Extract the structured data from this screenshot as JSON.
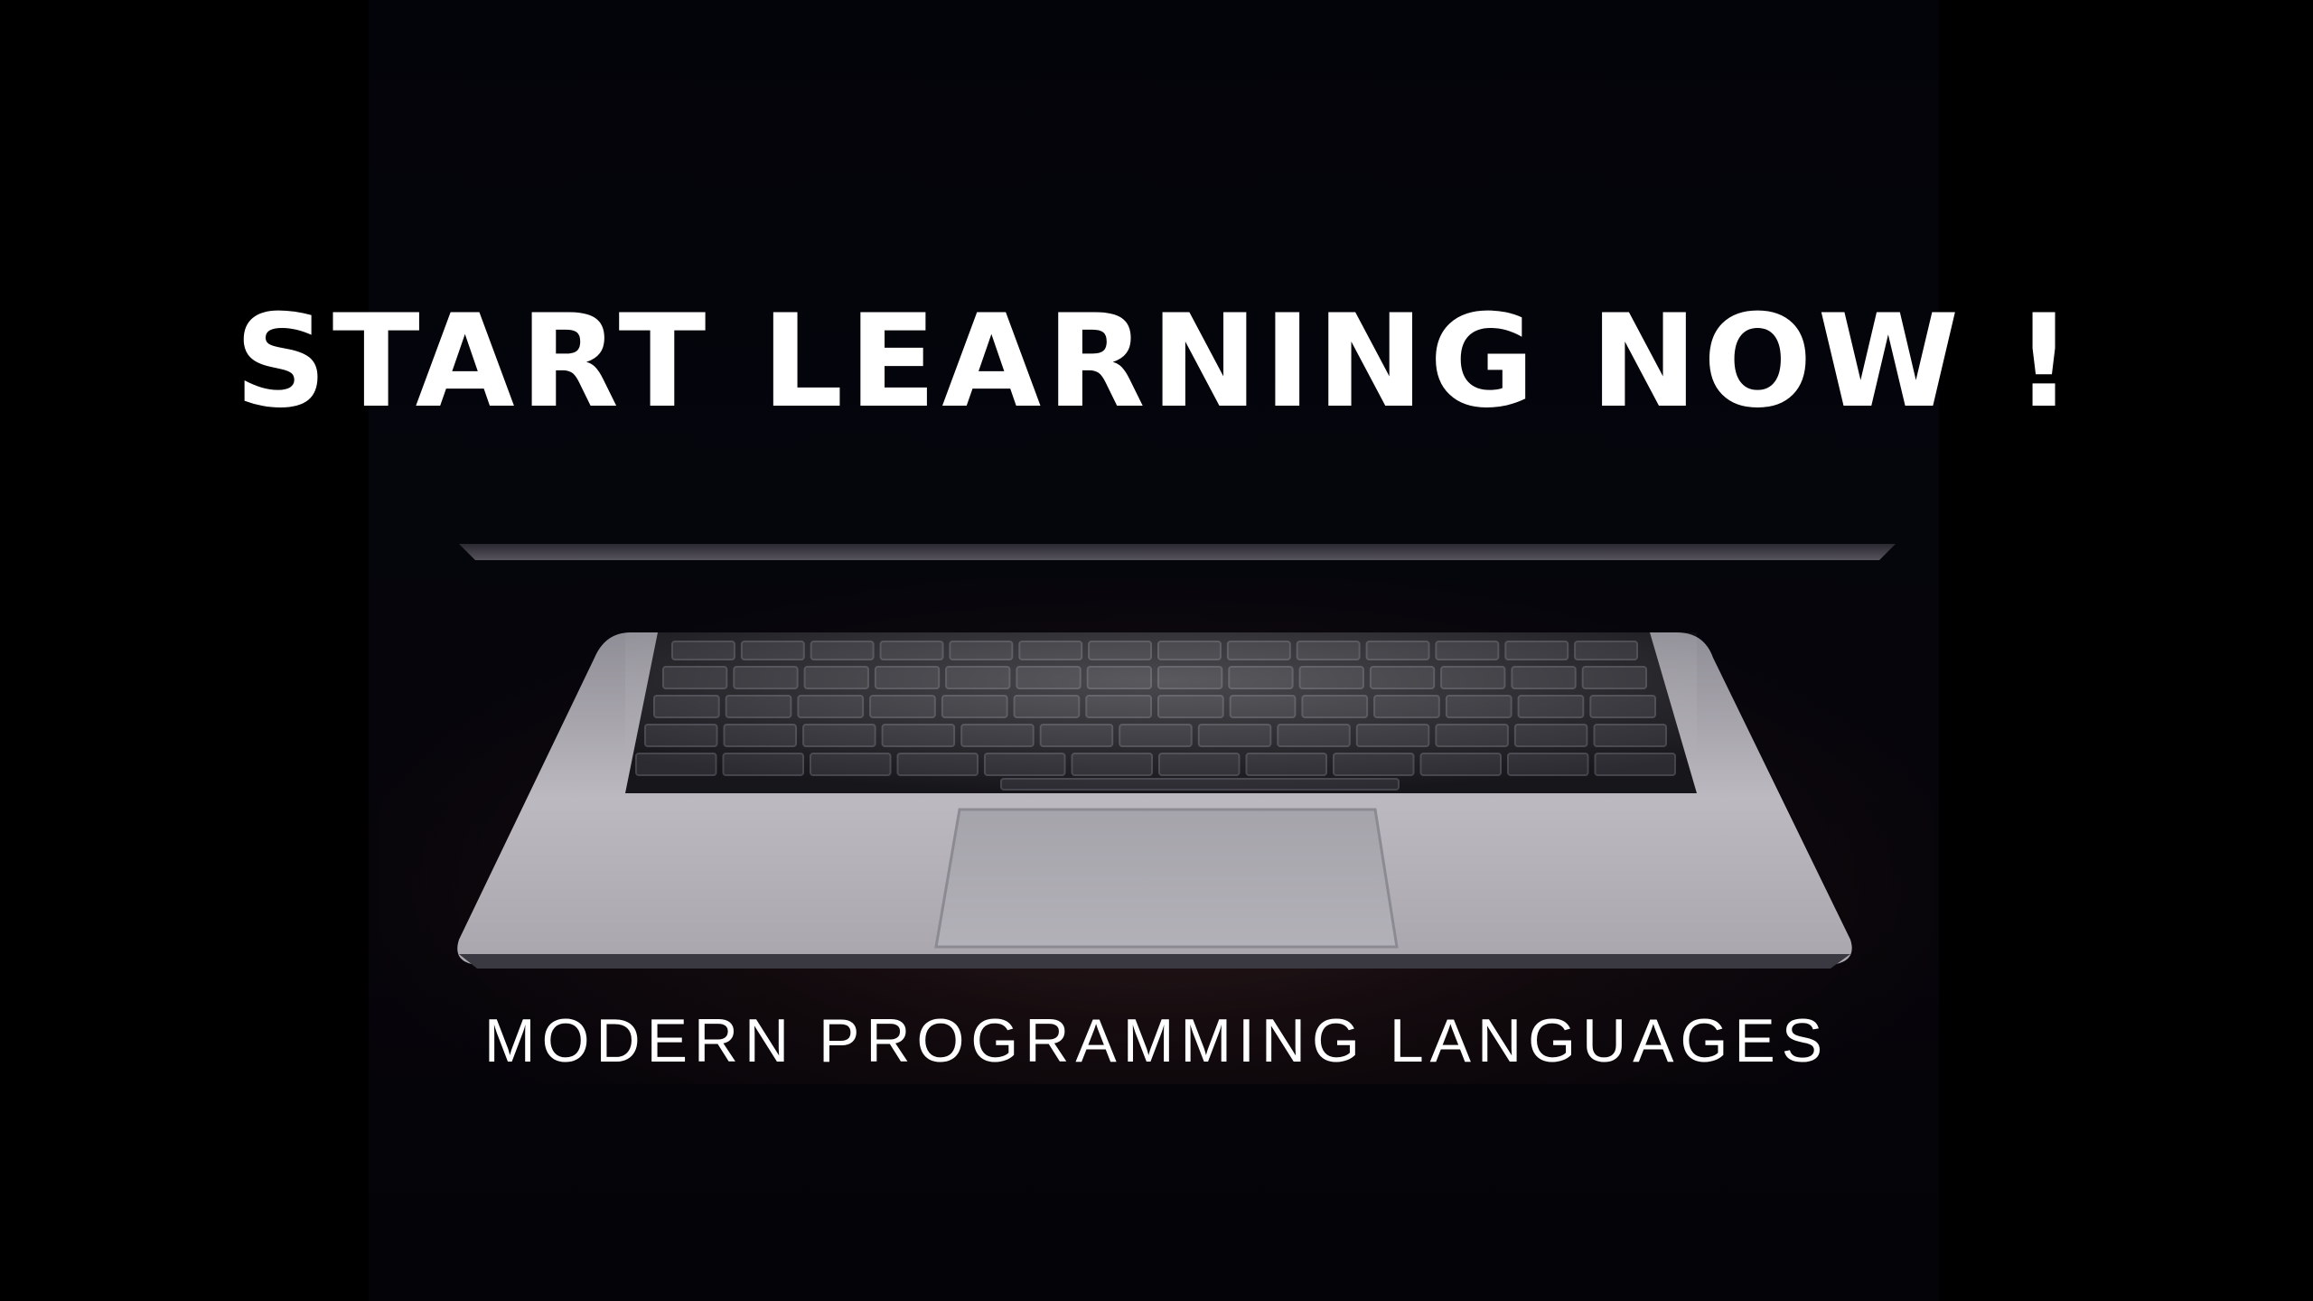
{
  "banner": {
    "headline": "START LEARNING NOW !",
    "subheadline": "MODERN PROGRAMMING LANGUAGES"
  },
  "photo": {
    "subject": "laptop-icon"
  },
  "colors": {
    "background": "#000000",
    "text": "#ffffff",
    "laptop_body": "#b9b7bd",
    "keys": "#26262c"
  }
}
